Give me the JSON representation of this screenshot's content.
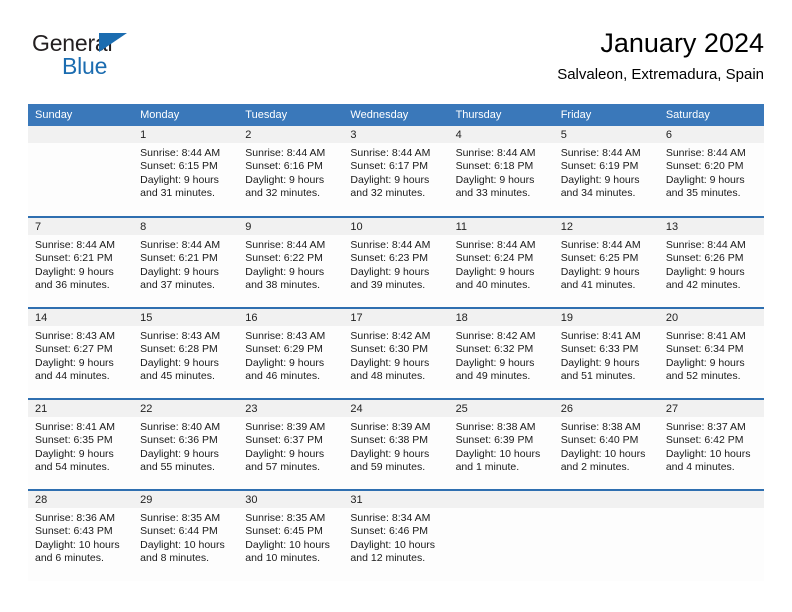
{
  "brand": {
    "line1": "General",
    "line2": "Blue",
    "accent_color": "#1b6cb0",
    "triangle_icon": "brand-triangle-icon"
  },
  "header": {
    "title": "January 2024",
    "subtitle": "Salvaleon, Extremadura, Spain"
  },
  "theme": {
    "header_blue": "#3a78ba",
    "row_divider_blue": "#2f6fb0",
    "daynum_band": "#f1f1f1"
  },
  "calendar": {
    "weekday_headers": [
      "Sunday",
      "Monday",
      "Tuesday",
      "Wednesday",
      "Thursday",
      "Friday",
      "Saturday"
    ],
    "weeks": [
      [
        {
          "day": "",
          "sunrise": "",
          "sunset": "",
          "daylight_line1": "",
          "daylight_line2": "",
          "empty": true
        },
        {
          "day": "1",
          "sunrise": "Sunrise: 8:44 AM",
          "sunset": "Sunset: 6:15 PM",
          "daylight_line1": "Daylight: 9 hours",
          "daylight_line2": "and 31 minutes.",
          "empty": false
        },
        {
          "day": "2",
          "sunrise": "Sunrise: 8:44 AM",
          "sunset": "Sunset: 6:16 PM",
          "daylight_line1": "Daylight: 9 hours",
          "daylight_line2": "and 32 minutes.",
          "empty": false
        },
        {
          "day": "3",
          "sunrise": "Sunrise: 8:44 AM",
          "sunset": "Sunset: 6:17 PM",
          "daylight_line1": "Daylight: 9 hours",
          "daylight_line2": "and 32 minutes.",
          "empty": false
        },
        {
          "day": "4",
          "sunrise": "Sunrise: 8:44 AM",
          "sunset": "Sunset: 6:18 PM",
          "daylight_line1": "Daylight: 9 hours",
          "daylight_line2": "and 33 minutes.",
          "empty": false
        },
        {
          "day": "5",
          "sunrise": "Sunrise: 8:44 AM",
          "sunset": "Sunset: 6:19 PM",
          "daylight_line1": "Daylight: 9 hours",
          "daylight_line2": "and 34 minutes.",
          "empty": false
        },
        {
          "day": "6",
          "sunrise": "Sunrise: 8:44 AM",
          "sunset": "Sunset: 6:20 PM",
          "daylight_line1": "Daylight: 9 hours",
          "daylight_line2": "and 35 minutes.",
          "empty": false
        }
      ],
      [
        {
          "day": "7",
          "sunrise": "Sunrise: 8:44 AM",
          "sunset": "Sunset: 6:21 PM",
          "daylight_line1": "Daylight: 9 hours",
          "daylight_line2": "and 36 minutes.",
          "empty": false
        },
        {
          "day": "8",
          "sunrise": "Sunrise: 8:44 AM",
          "sunset": "Sunset: 6:21 PM",
          "daylight_line1": "Daylight: 9 hours",
          "daylight_line2": "and 37 minutes.",
          "empty": false
        },
        {
          "day": "9",
          "sunrise": "Sunrise: 8:44 AM",
          "sunset": "Sunset: 6:22 PM",
          "daylight_line1": "Daylight: 9 hours",
          "daylight_line2": "and 38 minutes.",
          "empty": false
        },
        {
          "day": "10",
          "sunrise": "Sunrise: 8:44 AM",
          "sunset": "Sunset: 6:23 PM",
          "daylight_line1": "Daylight: 9 hours",
          "daylight_line2": "and 39 minutes.",
          "empty": false
        },
        {
          "day": "11",
          "sunrise": "Sunrise: 8:44 AM",
          "sunset": "Sunset: 6:24 PM",
          "daylight_line1": "Daylight: 9 hours",
          "daylight_line2": "and 40 minutes.",
          "empty": false
        },
        {
          "day": "12",
          "sunrise": "Sunrise: 8:44 AM",
          "sunset": "Sunset: 6:25 PM",
          "daylight_line1": "Daylight: 9 hours",
          "daylight_line2": "and 41 minutes.",
          "empty": false
        },
        {
          "day": "13",
          "sunrise": "Sunrise: 8:44 AM",
          "sunset": "Sunset: 6:26 PM",
          "daylight_line1": "Daylight: 9 hours",
          "daylight_line2": "and 42 minutes.",
          "empty": false
        }
      ],
      [
        {
          "day": "14",
          "sunrise": "Sunrise: 8:43 AM",
          "sunset": "Sunset: 6:27 PM",
          "daylight_line1": "Daylight: 9 hours",
          "daylight_line2": "and 44 minutes.",
          "empty": false
        },
        {
          "day": "15",
          "sunrise": "Sunrise: 8:43 AM",
          "sunset": "Sunset: 6:28 PM",
          "daylight_line1": "Daylight: 9 hours",
          "daylight_line2": "and 45 minutes.",
          "empty": false
        },
        {
          "day": "16",
          "sunrise": "Sunrise: 8:43 AM",
          "sunset": "Sunset: 6:29 PM",
          "daylight_line1": "Daylight: 9 hours",
          "daylight_line2": "and 46 minutes.",
          "empty": false
        },
        {
          "day": "17",
          "sunrise": "Sunrise: 8:42 AM",
          "sunset": "Sunset: 6:30 PM",
          "daylight_line1": "Daylight: 9 hours",
          "daylight_line2": "and 48 minutes.",
          "empty": false
        },
        {
          "day": "18",
          "sunrise": "Sunrise: 8:42 AM",
          "sunset": "Sunset: 6:32 PM",
          "daylight_line1": "Daylight: 9 hours",
          "daylight_line2": "and 49 minutes.",
          "empty": false
        },
        {
          "day": "19",
          "sunrise": "Sunrise: 8:41 AM",
          "sunset": "Sunset: 6:33 PM",
          "daylight_line1": "Daylight: 9 hours",
          "daylight_line2": "and 51 minutes.",
          "empty": false
        },
        {
          "day": "20",
          "sunrise": "Sunrise: 8:41 AM",
          "sunset": "Sunset: 6:34 PM",
          "daylight_line1": "Daylight: 9 hours",
          "daylight_line2": "and 52 minutes.",
          "empty": false
        }
      ],
      [
        {
          "day": "21",
          "sunrise": "Sunrise: 8:41 AM",
          "sunset": "Sunset: 6:35 PM",
          "daylight_line1": "Daylight: 9 hours",
          "daylight_line2": "and 54 minutes.",
          "empty": false
        },
        {
          "day": "22",
          "sunrise": "Sunrise: 8:40 AM",
          "sunset": "Sunset: 6:36 PM",
          "daylight_line1": "Daylight: 9 hours",
          "daylight_line2": "and 55 minutes.",
          "empty": false
        },
        {
          "day": "23",
          "sunrise": "Sunrise: 8:39 AM",
          "sunset": "Sunset: 6:37 PM",
          "daylight_line1": "Daylight: 9 hours",
          "daylight_line2": "and 57 minutes.",
          "empty": false
        },
        {
          "day": "24",
          "sunrise": "Sunrise: 8:39 AM",
          "sunset": "Sunset: 6:38 PM",
          "daylight_line1": "Daylight: 9 hours",
          "daylight_line2": "and 59 minutes.",
          "empty": false
        },
        {
          "day": "25",
          "sunrise": "Sunrise: 8:38 AM",
          "sunset": "Sunset: 6:39 PM",
          "daylight_line1": "Daylight: 10 hours",
          "daylight_line2": "and 1 minute.",
          "empty": false
        },
        {
          "day": "26",
          "sunrise": "Sunrise: 8:38 AM",
          "sunset": "Sunset: 6:40 PM",
          "daylight_line1": "Daylight: 10 hours",
          "daylight_line2": "and 2 minutes.",
          "empty": false
        },
        {
          "day": "27",
          "sunrise": "Sunrise: 8:37 AM",
          "sunset": "Sunset: 6:42 PM",
          "daylight_line1": "Daylight: 10 hours",
          "daylight_line2": "and 4 minutes.",
          "empty": false
        }
      ],
      [
        {
          "day": "28",
          "sunrise": "Sunrise: 8:36 AM",
          "sunset": "Sunset: 6:43 PM",
          "daylight_line1": "Daylight: 10 hours",
          "daylight_line2": "and 6 minutes.",
          "empty": false
        },
        {
          "day": "29",
          "sunrise": "Sunrise: 8:35 AM",
          "sunset": "Sunset: 6:44 PM",
          "daylight_line1": "Daylight: 10 hours",
          "daylight_line2": "and 8 minutes.",
          "empty": false
        },
        {
          "day": "30",
          "sunrise": "Sunrise: 8:35 AM",
          "sunset": "Sunset: 6:45 PM",
          "daylight_line1": "Daylight: 10 hours",
          "daylight_line2": "and 10 minutes.",
          "empty": false
        },
        {
          "day": "31",
          "sunrise": "Sunrise: 8:34 AM",
          "sunset": "Sunset: 6:46 PM",
          "daylight_line1": "Daylight: 10 hours",
          "daylight_line2": "and 12 minutes.",
          "empty": false
        },
        {
          "day": "",
          "sunrise": "",
          "sunset": "",
          "daylight_line1": "",
          "daylight_line2": "",
          "empty": true
        },
        {
          "day": "",
          "sunrise": "",
          "sunset": "",
          "daylight_line1": "",
          "daylight_line2": "",
          "empty": true
        },
        {
          "day": "",
          "sunrise": "",
          "sunset": "",
          "daylight_line1": "",
          "daylight_line2": "",
          "empty": true
        }
      ]
    ]
  }
}
